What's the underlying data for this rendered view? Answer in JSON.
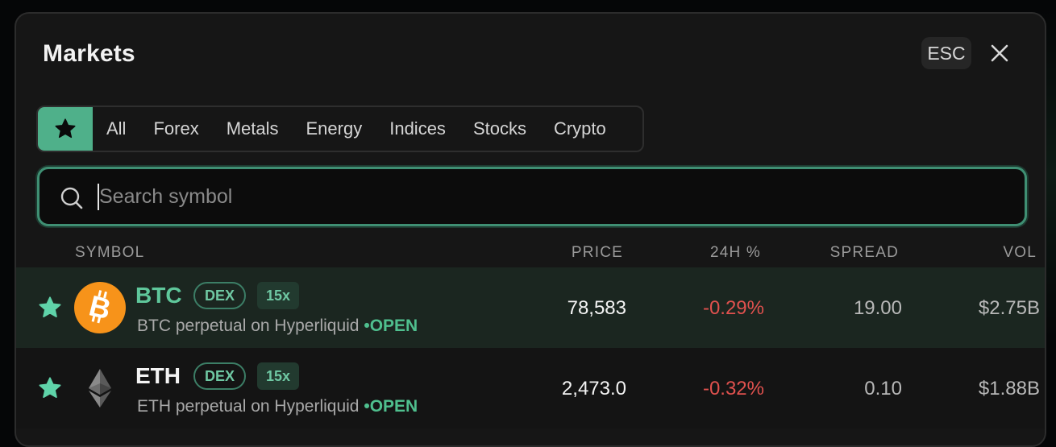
{
  "modal": {
    "title": "Markets",
    "esc_label": "ESC"
  },
  "tabs": [
    "All",
    "Forex",
    "Metals",
    "Energy",
    "Indices",
    "Stocks",
    "Crypto"
  ],
  "search": {
    "placeholder": "Search symbol",
    "value": ""
  },
  "columns": {
    "symbol": "SYMBOL",
    "price": "PRICE",
    "change": "24H %",
    "spread": "SPREAD",
    "vol": "VOL"
  },
  "rows": [
    {
      "symbol": "BTC",
      "badge": "DEX",
      "leverage": "15x",
      "description": "BTC perpetual on Hyperliquid",
      "status": "OPEN",
      "price": "78,583",
      "change": "-0.29%",
      "spread": "19.00",
      "vol": "$2.75B",
      "icon": "bitcoin-icon"
    },
    {
      "symbol": "ETH",
      "badge": "DEX",
      "leverage": "15x",
      "description": "ETH perpetual on Hyperliquid",
      "status": "OPEN",
      "price": "2,473.0",
      "change": "-0.32%",
      "spread": "0.10",
      "vol": "$1.88B",
      "icon": "ethereum-icon"
    }
  ],
  "colors": {
    "accent": "#4fb08a",
    "negative": "#e0514e",
    "bitcoin": "#f7931a"
  }
}
